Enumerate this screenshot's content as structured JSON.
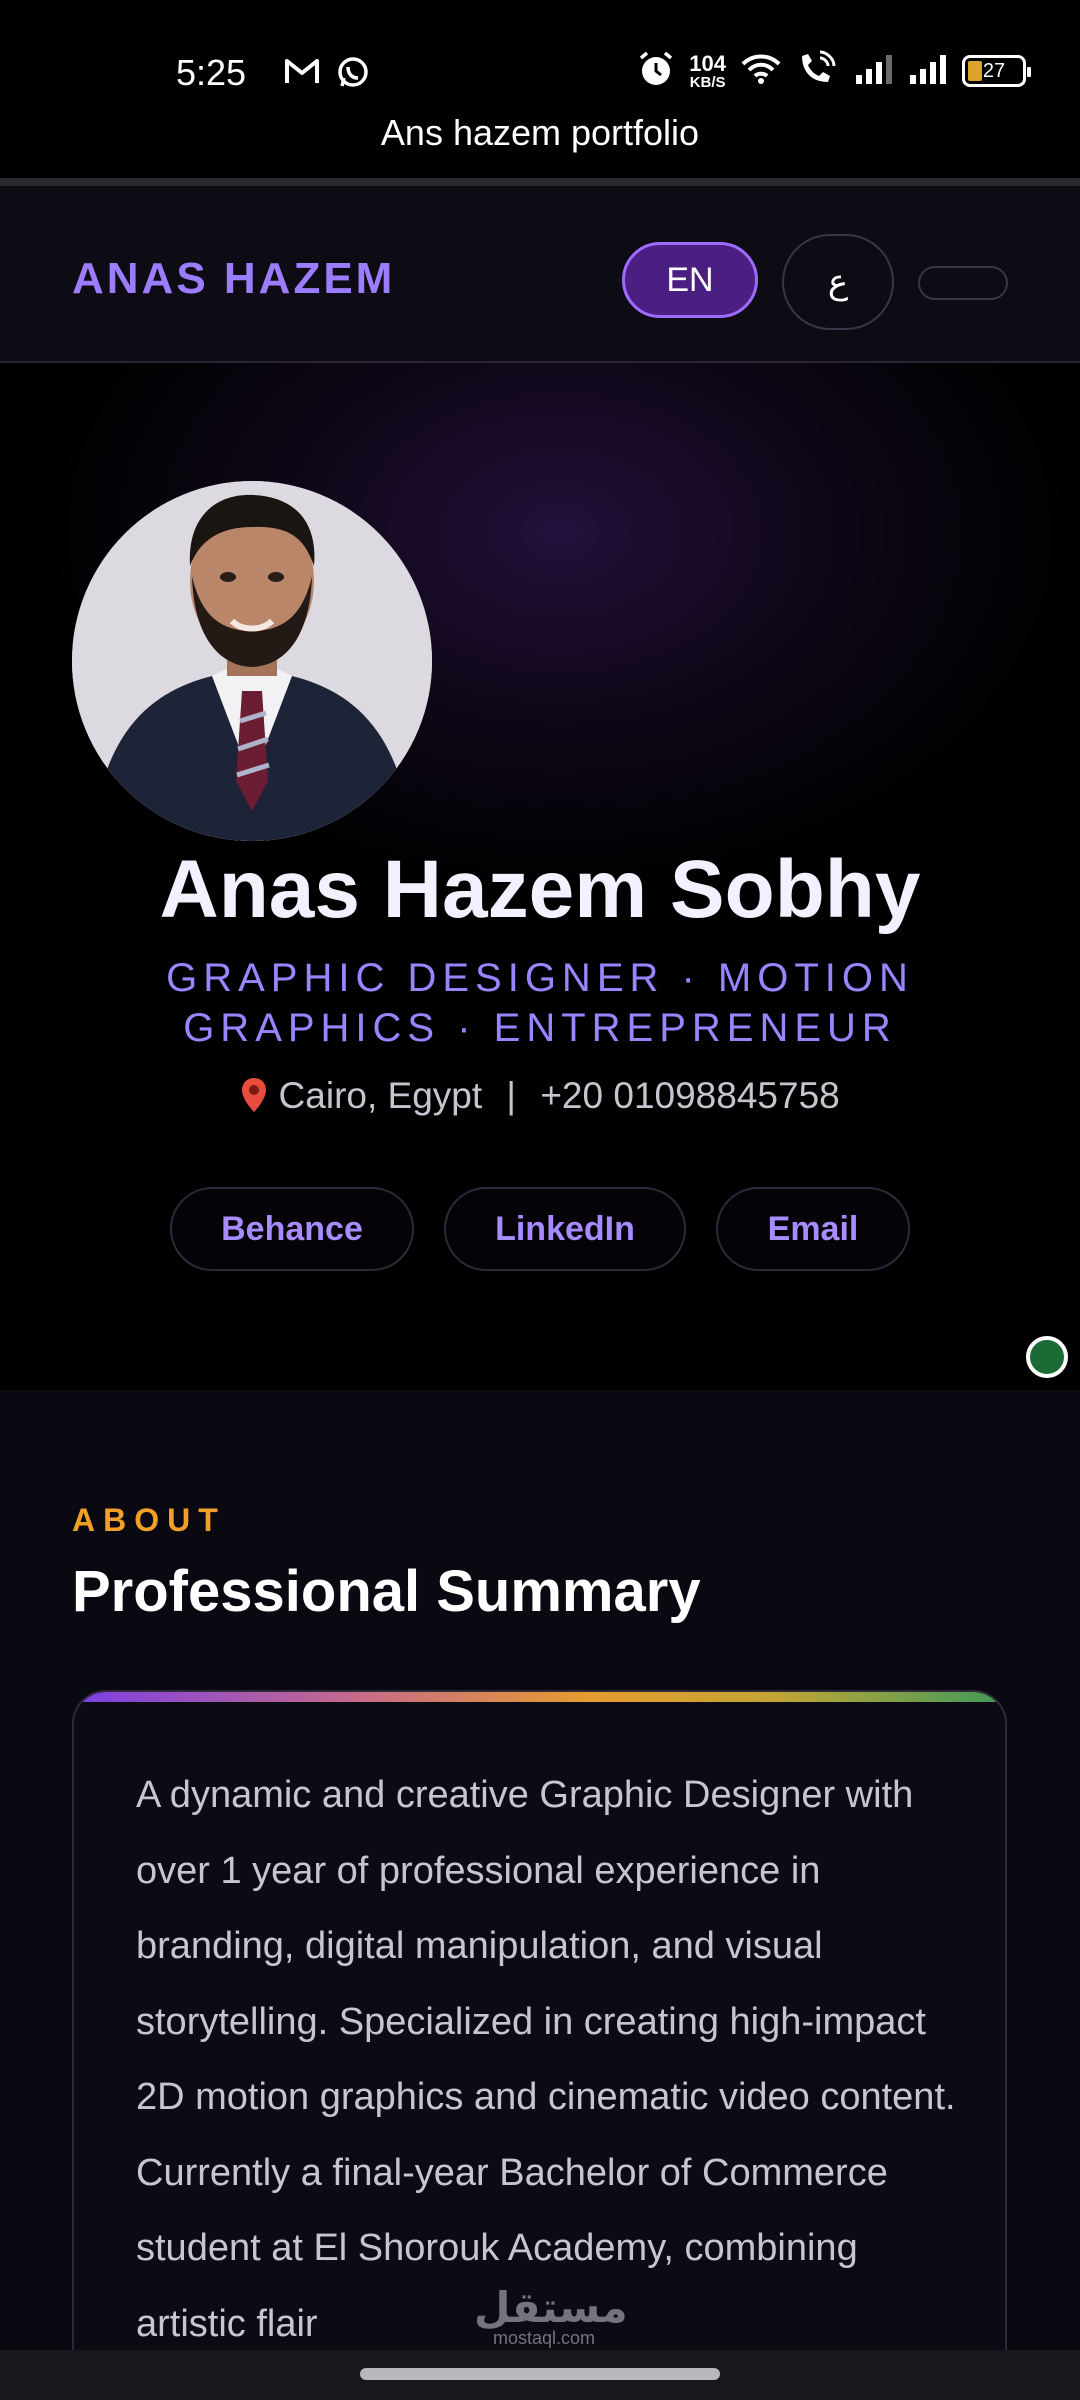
{
  "status_bar": {
    "time": "5:25",
    "network_speed_value": "104",
    "network_speed_unit": "KB/S",
    "battery_level": "27",
    "icons": [
      "gmail-icon",
      "whatsapp-icon",
      "alarm-icon",
      "wifi-icon",
      "wifi-call-icon",
      "signal-icon",
      "signal-icon",
      "battery-icon"
    ]
  },
  "page_title": "Ans hazem portfolio",
  "header": {
    "brand": "ANAS HAZEM",
    "lang_en": "EN",
    "lang_ar": "ع"
  },
  "hero": {
    "name": "Anas Hazem Sobhy",
    "role_line1": "GRAPHIC DESIGNER · MOTION",
    "role_line2": "GRAPHICS · ENTREPRENEUR",
    "location": "Cairo, Egypt",
    "separator": "|",
    "phone": "+20 01098845758",
    "links": [
      "Behance",
      "LinkedIn",
      "Email"
    ]
  },
  "about": {
    "label": "ABOUT",
    "title": "Professional Summary",
    "summary": "A dynamic and creative Graphic Designer with over 1 year of professional experience in branding, digital manipulation, and visual storytelling. Specialized in creating high-impact 2D motion graphics and cinematic video content. Currently a final-year Bachelor of Commerce student at El Shorouk Academy, combining artistic flair"
  },
  "watermark": {
    "arabic": "مستقل",
    "latin": "mostaql.com"
  },
  "colors": {
    "accent": "#9d7dff",
    "about_label": "#f0a028",
    "background": "#000000"
  }
}
